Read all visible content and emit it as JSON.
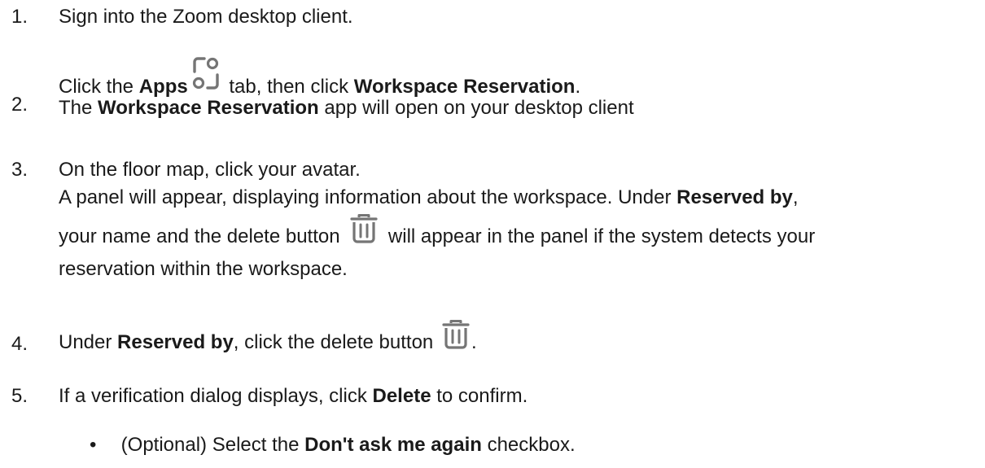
{
  "steps": [
    {
      "num": "1.",
      "text": "Sign into the Zoom desktop client."
    },
    {
      "num": "2.",
      "pre": "Click the ",
      "bold1": "Apps",
      "mid": " tab, then click ",
      "bold2": "Workspace Reservation",
      "post": ".",
      "line2_pre": "The ",
      "line2_bold": "Workspace Reservation",
      "line2_post": " app will open on your desktop client",
      "icon": "apps-icon"
    },
    {
      "num": "3.",
      "line1": "On the floor map, click your avatar.",
      "line2_pre": "A panel will appear, displaying information about the workspace. Under ",
      "line2_bold": "Reserved by",
      "line2_post": ",",
      "line3_pre": "your name and the delete button ",
      "line3_post": " will appear in the panel if the system detects your",
      "line4": "reservation within the workspace.",
      "icon": "trash-icon"
    },
    {
      "num": "4.",
      "pre": "Under ",
      "bold": "Reserved by",
      "mid": ", click the delete button ",
      "post": ".",
      "icon": "trash-icon"
    },
    {
      "num": "5.",
      "pre": "If a verification dialog displays, click ",
      "bold": "Delete",
      "post": " to confirm."
    }
  ],
  "bullet": {
    "mark": "•",
    "pre": "(Optional) Select the ",
    "bold": "Don't ask me again",
    "post": " checkbox."
  },
  "colors": {
    "text": "#1a1a1a",
    "icon": "#757575"
  }
}
